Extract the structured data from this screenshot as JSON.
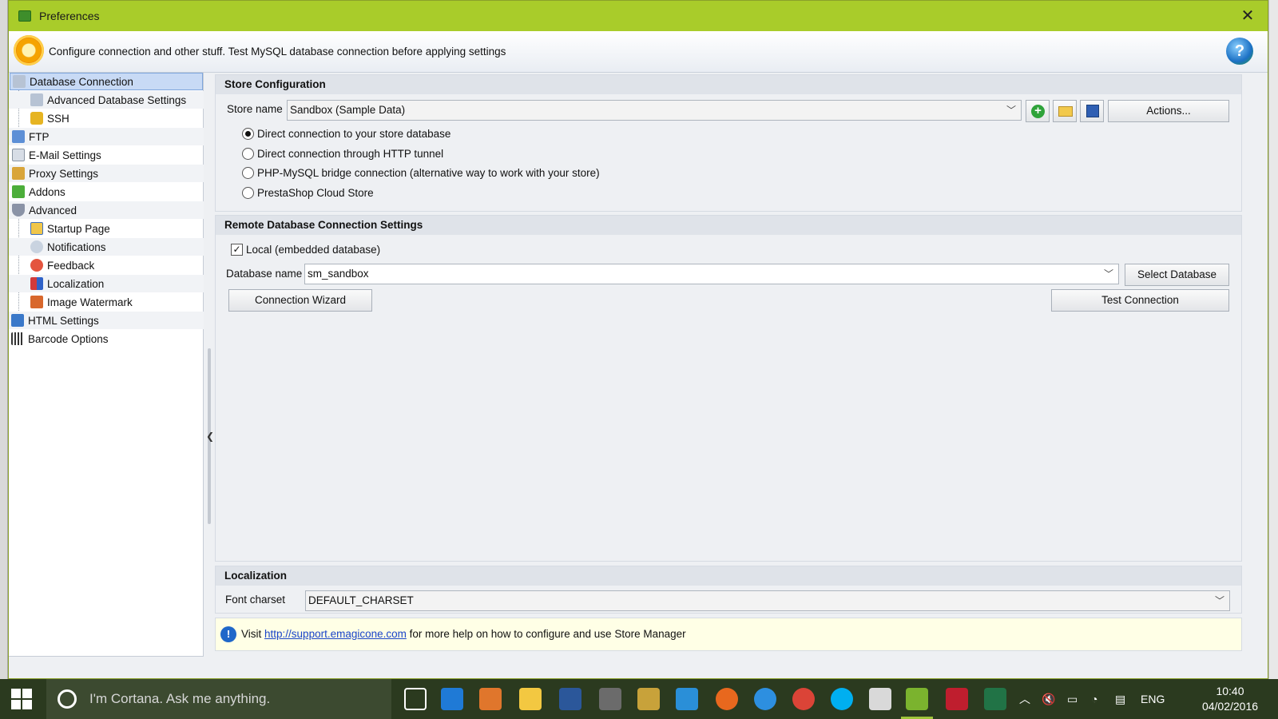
{
  "window": {
    "title": "Preferences",
    "close_glyph": "✕",
    "header_text": "Configure connection and other stuff. Test MySQL database connection before applying settings"
  },
  "tree": {
    "items": [
      {
        "label": "Database Connection"
      },
      {
        "label": "Advanced Database Settings"
      },
      {
        "label": "SSH"
      },
      {
        "label": "FTP"
      },
      {
        "label": "E-Mail Settings"
      },
      {
        "label": "Proxy Settings"
      },
      {
        "label": "Addons"
      },
      {
        "label": "Advanced"
      },
      {
        "label": "Startup Page"
      },
      {
        "label": "Notifications"
      },
      {
        "label": "Feedback"
      },
      {
        "label": "Localization"
      },
      {
        "label": "Image Watermark"
      },
      {
        "label": "HTML Settings"
      },
      {
        "label": "Barcode Options"
      }
    ]
  },
  "store_config": {
    "heading": "Store Configuration",
    "store_name_label": "Store name",
    "store_name_value": "Sandbox (Sample Data)",
    "actions_label": "Actions...",
    "radios": [
      {
        "label": "Direct connection to your store database",
        "checked": true
      },
      {
        "label": "Direct connection through HTTP tunnel",
        "checked": false
      },
      {
        "label": "PHP-MySQL bridge connection (alternative way to work with your store)",
        "checked": false
      },
      {
        "label": "PrestaShop Cloud Store",
        "checked": false
      }
    ]
  },
  "remote_db": {
    "heading": "Remote Database Connection Settings",
    "local_label": "Local (embedded database)",
    "local_checked": true,
    "db_name_label": "Database name",
    "db_name_value": "sm_sandbox",
    "select_db_label": "Select Database",
    "wizard_label": "Connection Wizard",
    "test_label": "Test Connection"
  },
  "localization": {
    "heading": "Localization",
    "charset_label": "Font charset",
    "charset_value": "DEFAULT_CHARSET"
  },
  "info": {
    "prefix": "Visit",
    "link": "http://support.emagicone.com",
    "suffix": "for more help on how to configure and use Store Manager"
  },
  "taskbar": {
    "cortana_placeholder": "I'm Cortana. Ask me anything.",
    "language": "ENG",
    "time": "10:40",
    "date": "04/02/2016"
  },
  "colors": {
    "titlebar": "#a9cc2a",
    "taskbar": "#2b3a1f",
    "selection": "#c8daf5",
    "link": "#1a44c8"
  }
}
